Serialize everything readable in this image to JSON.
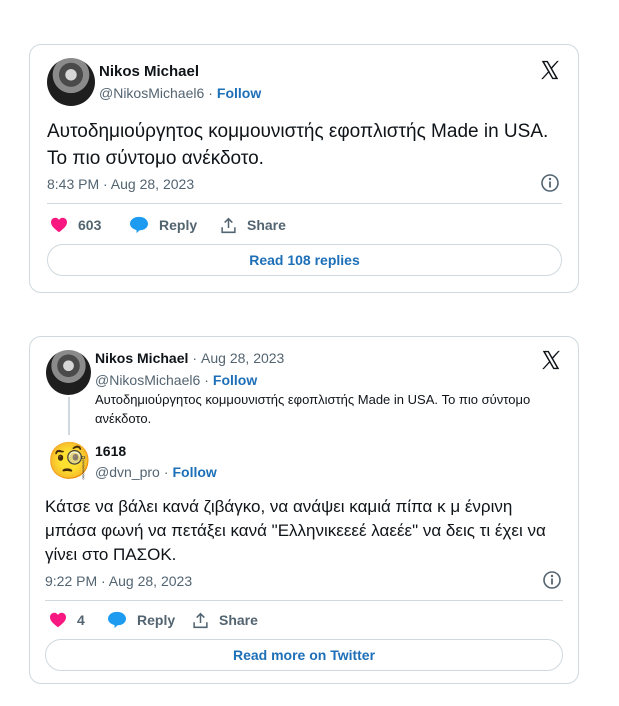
{
  "tweet1": {
    "author_name": "Nikos Michael",
    "author_handle": "@NikosMichael6",
    "separator": "·",
    "follow_label": "Follow",
    "text": "Αυτοδημιούργητος κομμουνιστής εφοπλιστής Made in USA. Το πιο σύντομο ανέκδοτο.",
    "timestamp": "8:43 PM · Aug 28, 2023",
    "like_count": "603",
    "reply_label": "Reply",
    "share_label": "Share",
    "read_replies_label": "Read 108 replies"
  },
  "tweet2": {
    "quoted": {
      "author_name": "Nikos Michael",
      "date": "Aug 28, 2023",
      "author_handle": "@NikosMichael6",
      "follow_label": "Follow",
      "text": "Αυτοδημιούργητος κομμουνιστής εφοπλιστής Made in USA. Το πιο σύντομο ανέκδοτο."
    },
    "author_name": "1618",
    "author_handle": "@dvn_pro",
    "separator": "·",
    "follow_label": "Follow",
    "avatar_emoji": "🧐",
    "text": "Κάτσε να βάλει κανά ζιβάγκο, να ανάψει καμιά πίπα κ μ ένρινη μπάσα φωνή να πετάξει κανά \"Ελληνικεεεέ λαεέε\" να δεις τι έχει να γίνει στο ΠΑΣΟΚ.",
    "timestamp": "9:22 PM · Aug 28, 2023",
    "like_count": "4",
    "reply_label": "Reply",
    "share_label": "Share",
    "read_more_label": "Read more on Twitter"
  },
  "colors": {
    "text": "#0f1419",
    "muted": "#536471",
    "link": "#1d6fb8",
    "heart": "#f91880",
    "reply_bubble": "#1d9bf0",
    "border": "#cfd9de"
  },
  "icons": [
    "x-logo-icon",
    "info-icon",
    "heart-icon",
    "reply-icon",
    "share-icon"
  ]
}
